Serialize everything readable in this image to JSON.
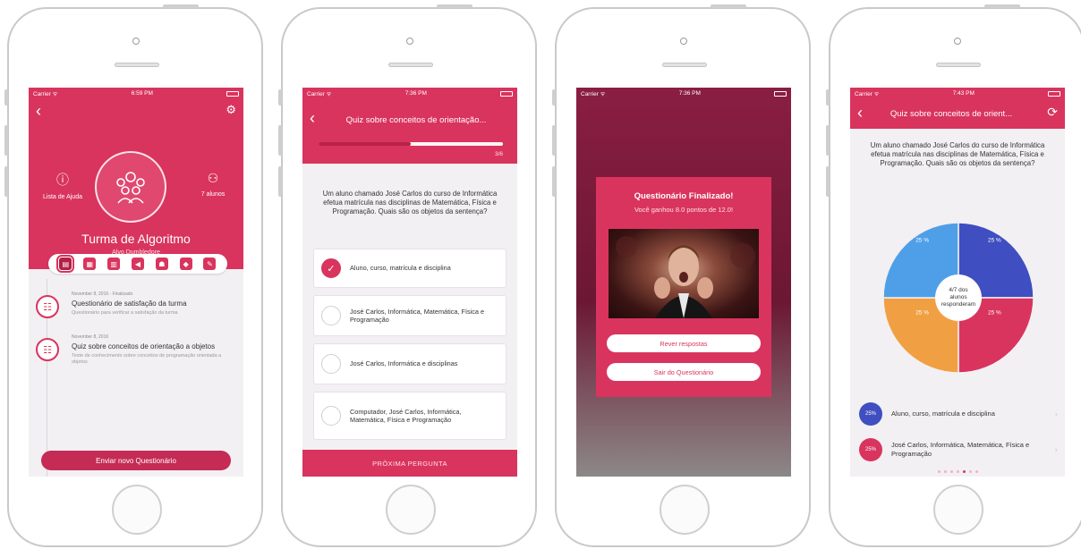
{
  "status": {
    "s1": {
      "carrier": "Carrier ᯤ",
      "time": "6:59 PM"
    },
    "s2": {
      "carrier": "Carrier ᯤ",
      "time": "7:36 PM"
    },
    "s3": {
      "carrier": "Carrier ᯤ",
      "time": "7:36 PM"
    },
    "s4": {
      "carrier": "Carrier ᯤ",
      "time": "7:43 PM"
    }
  },
  "screen1": {
    "help_label": "Lista de Ajuda",
    "students_label": "7 alunos",
    "class_title": "Turma de Algoritmo",
    "teacher": "Alvo Dumbledore",
    "toolbar_icons": [
      "clipboard-icon",
      "calendar-icon",
      "grid-icon",
      "megaphone-icon",
      "group-icon",
      "badge-icon",
      "chat-icon"
    ],
    "timeline": [
      {
        "date": "November 8, 2016 - Finalizado",
        "title": "Questionário de satisfação da turma",
        "desc": "Questionário para verificar a satisfação da turma"
      },
      {
        "date": "November 8, 2016",
        "title": "Quiz sobre conceitos de orientação a objetos",
        "desc": "Teste de conhecimento sobre conceitos de programação orientada a objetos"
      }
    ],
    "send_button": "Enviar novo Questionário"
  },
  "screen2": {
    "title": "Quiz sobre conceitos de orientação...",
    "progress": 0.5,
    "progress_label": "3/6",
    "question": "Um aluno chamado José Carlos do curso de Informática efetua matrícula nas disciplinas de Matemática, Física e Programação. Quais são os objetos da sentença?",
    "options": [
      {
        "text": "Aluno, curso, matrícula e disciplina",
        "checked": true
      },
      {
        "text": "José Carlos, Informática, Matemática, Física e Programação",
        "checked": false
      },
      {
        "text": "José Carlos, Informática e disciplinas",
        "checked": false
      },
      {
        "text": "Computador, José Carlos, Informática, Matemática, Física e Programação",
        "checked": false
      }
    ],
    "next_button": "PRÓXIMA PERGUNTA"
  },
  "screen3": {
    "title": "Questionário Finalizado!",
    "subtitle": "Você ganhou 8.0 pontos de 12.0!",
    "review_button": "Rever respostas",
    "exit_button": "Sair do Questionário"
  },
  "screen4": {
    "title": "Quiz sobre conceitos de orient...",
    "question": "Um aluno chamado José Carlos do curso de Informática efetua matrícula nas disciplinas de Matemática, Física e Programação. Quais são os objetos da sentença?",
    "center_label": "4/7 dos alunos responderam",
    "legend": [
      {
        "badge": "25%",
        "text": "Aluno, curso, matrícula e disciplina",
        "color": "#3f4ec0"
      },
      {
        "badge": "25%",
        "text": "José Carlos, Informática, Matemática, Física e Programação",
        "color": "#d9345e"
      }
    ],
    "page_dots": 7,
    "active_dot": 4
  },
  "chart_data": {
    "type": "pie",
    "categories": [
      "Aluno, curso, matrícula e disciplina",
      "José Carlos, Informática, Matemática, Física e Programação",
      "",
      ""
    ],
    "values": [
      25,
      25,
      25,
      25
    ],
    "labels": [
      "25 %",
      "25 %",
      "25 %",
      "25 %"
    ],
    "colors": [
      "#3f4ec0",
      "#d9345e",
      "#f0a042",
      "#4f9fe8"
    ]
  }
}
